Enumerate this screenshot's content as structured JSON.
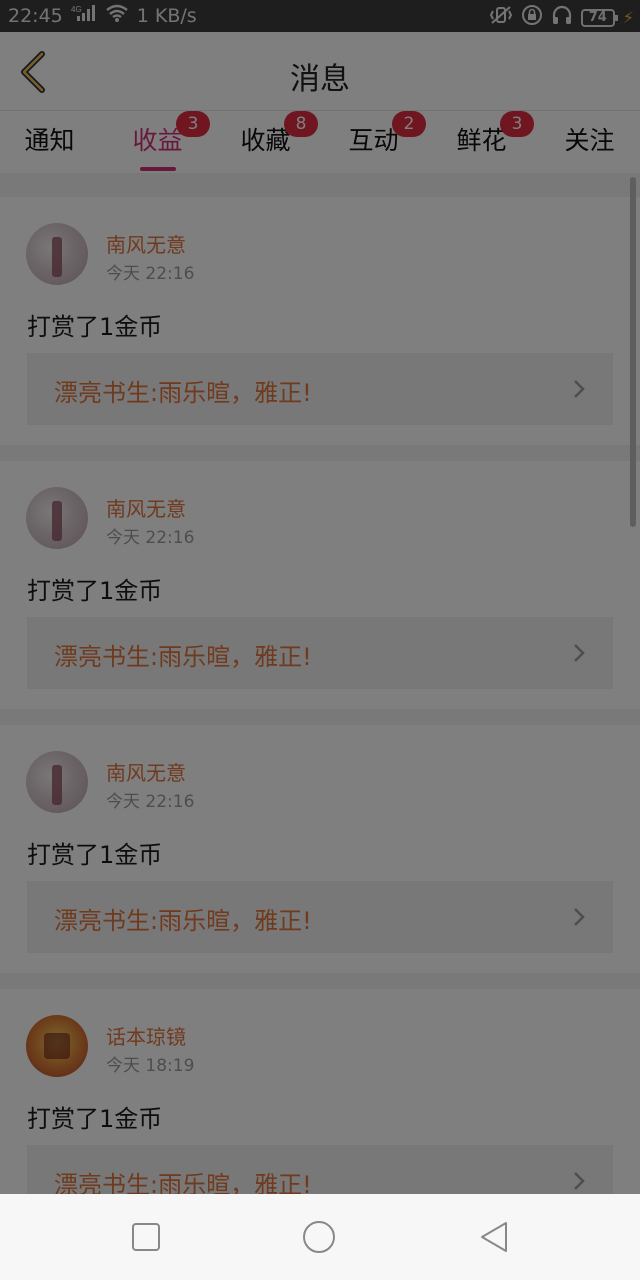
{
  "status_bar": {
    "time": "22:45",
    "network": "4G",
    "speed": "1 KB/s",
    "battery": "74",
    "icons": [
      "signal-icon",
      "wifi-icon",
      "vibrate-icon",
      "lock-rotation-icon",
      "headphones-icon",
      "battery-icon",
      "charging-icon"
    ]
  },
  "header": {
    "title": "消息"
  },
  "tabs": [
    {
      "label": "通知",
      "badge": ""
    },
    {
      "label": "收益",
      "badge": "3",
      "active": true
    },
    {
      "label": "收藏",
      "badge": "8"
    },
    {
      "label": "互动",
      "badge": "2"
    },
    {
      "label": "鲜花",
      "badge": "3"
    },
    {
      "label": "关注",
      "badge": ""
    }
  ],
  "feed": [
    {
      "name": "南风无意",
      "time": "今天 22:16",
      "message": "打赏了1金币",
      "quote": "漂亮书生:雨乐暄，雅正!"
    },
    {
      "name": "南风无意",
      "time": "今天 22:16",
      "message": "打赏了1金币",
      "quote": "漂亮书生:雨乐暄，雅正!"
    },
    {
      "name": "南风无意",
      "time": "今天 22:16",
      "message": "打赏了1金币",
      "quote": "漂亮书生:雨乐暄，雅正!"
    },
    {
      "name": "话本琼镜",
      "time": "今天 18:19",
      "message": "打赏了1金币",
      "quote": "漂亮书生:雨乐暄，雅正!"
    }
  ],
  "colors": {
    "accent": "#d2317a",
    "badge": "#e02d40",
    "name": "#e0753c"
  }
}
